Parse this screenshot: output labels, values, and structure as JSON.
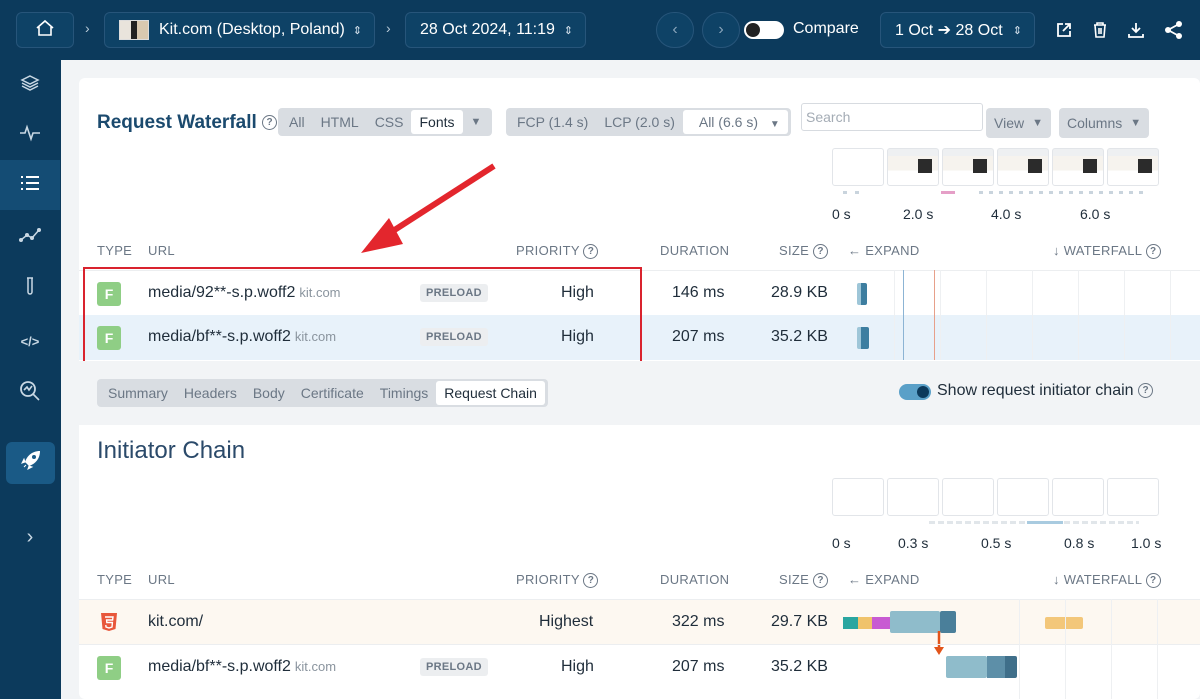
{
  "topbar": {
    "site_label": "Kit.com (Desktop, Poland)",
    "date_label": "28 Oct 2024, 11:19",
    "compare_label": "Compare",
    "range_label": "1 Oct ➔ 28 Oct"
  },
  "waterfall": {
    "title": "Request Waterfall",
    "type_filters": [
      "All",
      "HTML",
      "CSS",
      "Fonts"
    ],
    "type_filter_active": "Fonts",
    "milestone_filters": [
      "FCP (1.4 s)",
      "LCP (2.0 s)",
      "All (6.6 s)"
    ],
    "milestone_active": "All (6.6 s)",
    "search_placeholder": "Search",
    "view_label": "View",
    "columns_label": "Columns",
    "timeline_ticks": [
      "0 s",
      "2.0 s",
      "4.0 s",
      "6.0 s"
    ],
    "headers": {
      "type": "TYPE",
      "url": "URL",
      "priority": "PRIORITY",
      "duration": "DURATION",
      "size": "SIZE",
      "expand": "← EXPAND",
      "waterfall": "↓ WATERFALL"
    },
    "rows": [
      {
        "type": "F",
        "url": "media/92**-s.p.woff2",
        "domain": "kit.com",
        "tag": "PRELOAD",
        "priority": "High",
        "duration": "146 ms",
        "size": "28.9 KB"
      },
      {
        "type": "F",
        "url": "media/bf**-s.p.woff2",
        "domain": "kit.com",
        "tag": "PRELOAD",
        "priority": "High",
        "duration": "207 ms",
        "size": "35.2 KB"
      }
    ]
  },
  "detail_tabs": [
    "Summary",
    "Headers",
    "Body",
    "Certificate",
    "Timings",
    "Request Chain"
  ],
  "detail_tab_active": "Request Chain",
  "show_chain_label": "Show request initiator chain",
  "initiator": {
    "title": "Initiator Chain",
    "timeline_ticks": [
      "0 s",
      "0.3 s",
      "0.5 s",
      "0.8 s",
      "1.0 s"
    ],
    "rows": [
      {
        "type": "html",
        "url": "kit.com/",
        "domain": "",
        "tag": "",
        "priority": "Highest",
        "duration": "322 ms",
        "size": "29.7 KB"
      },
      {
        "type": "F",
        "url": "media/bf**-s.p.woff2",
        "domain": "kit.com",
        "tag": "PRELOAD",
        "priority": "High",
        "duration": "207 ms",
        "size": "35.2 KB"
      }
    ]
  },
  "colors": {
    "topbar": "#0c3a5c",
    "accent": "#1b4a6e",
    "highlight_border": "#d9232e",
    "row_selected": "#e8f2fa",
    "font_badge": "#8fce85",
    "html_badge": "#e8573b"
  },
  "icons": {
    "home": "home-icon",
    "share": "share-icon",
    "delete": "trash-icon",
    "download": "download-icon",
    "external": "external-link-icon"
  }
}
